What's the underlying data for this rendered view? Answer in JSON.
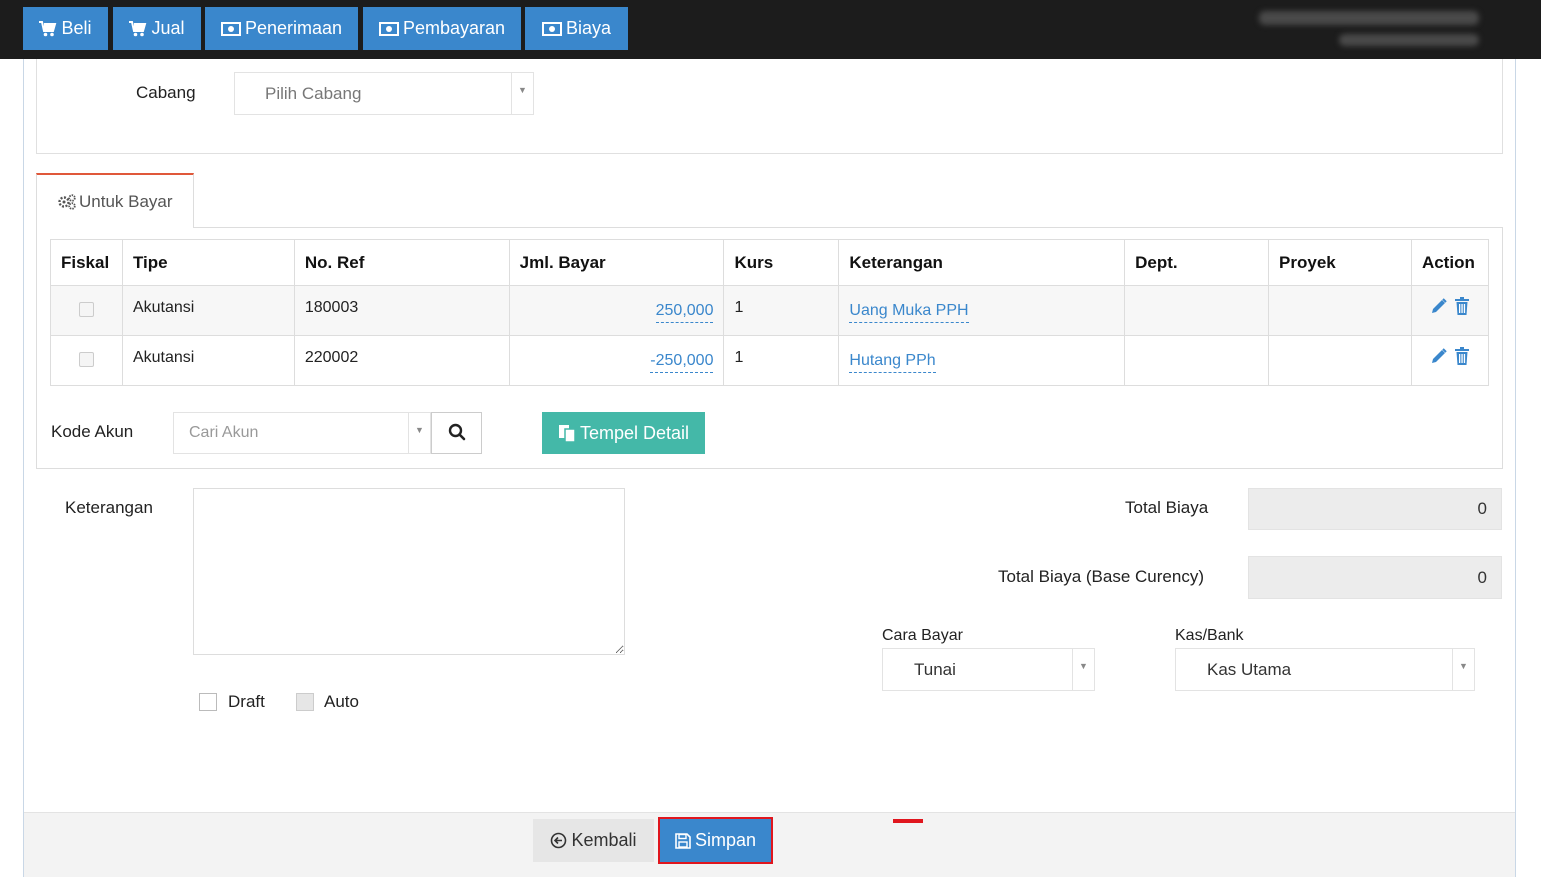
{
  "nav": {
    "buttons": [
      {
        "label": "Beli",
        "icon": "cart-icon"
      },
      {
        "label": "Jual",
        "icon": "cart-icon"
      },
      {
        "label": "Penerimaan",
        "icon": "money-icon"
      },
      {
        "label": "Pembayaran",
        "icon": "money-icon"
      },
      {
        "label": "Biaya",
        "icon": "money-icon"
      }
    ]
  },
  "form": {
    "cabang_label": "Cabang",
    "cabang_placeholder": "Pilih Cabang"
  },
  "tab": {
    "label": "Untuk Bayar"
  },
  "table": {
    "headers": [
      "Fiskal",
      "Tipe",
      "No. Ref",
      "Jml. Bayar",
      "Kurs",
      "Keterangan",
      "Dept.",
      "Proyek",
      "Action"
    ],
    "rows": [
      {
        "tipe": "Akutansi",
        "no_ref": "180003",
        "jml_bayar": "250,000",
        "kurs": "1",
        "keterangan": "Uang Muka PPH",
        "dept": "",
        "proyek": ""
      },
      {
        "tipe": "Akutansi",
        "no_ref": "220002",
        "jml_bayar": "-250,000",
        "kurs": "1",
        "keterangan": "Hutang PPh",
        "dept": "",
        "proyek": ""
      }
    ]
  },
  "kode_akun": {
    "label": "Kode Akun",
    "placeholder": "Cari Akun",
    "tempel_label": "Tempel Detail"
  },
  "bottom": {
    "keterangan_label": "Keterangan",
    "total_biaya_label": "Total Biaya",
    "total_biaya_value": "0",
    "total_base_label": "Total Biaya (Base Curency)",
    "total_base_value": "0",
    "cara_bayar_label": "Cara Bayar",
    "cara_bayar_value": "Tunai",
    "kas_bank_label": "Kas/Bank",
    "kas_bank_value": "Kas Utama",
    "draft_label": "Draft",
    "auto_label": "Auto"
  },
  "footer": {
    "kembali_label": "Kembali",
    "simpan_label": "Simpan"
  },
  "colors": {
    "primary": "#3a87cc",
    "teal": "#44b8a8",
    "tab_accent": "#e0583a",
    "highlight": "#e0161e",
    "topbar": "#1c1c1c"
  }
}
